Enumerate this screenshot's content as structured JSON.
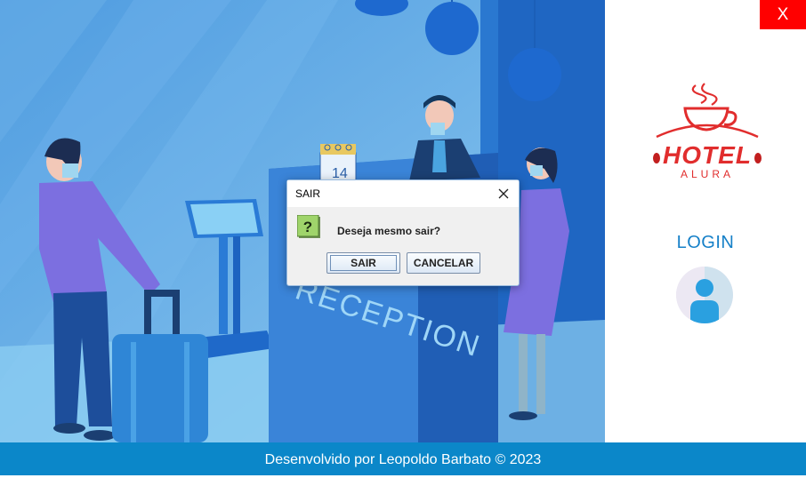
{
  "window": {
    "close_label": "X"
  },
  "scene": {
    "calendar_day": "14",
    "reception_sign": "RECEPTION"
  },
  "logo": {
    "word1": "HOTEL",
    "word2": "ALURA"
  },
  "login": {
    "label": "LOGIN"
  },
  "dialog": {
    "title": "SAIR",
    "message": "Deseja mesmo sair?",
    "confirm_label": "SAIR",
    "cancel_label": "CANCELAR",
    "icon": "question-icon"
  },
  "footer": {
    "text": "Desenvolvido por Leopoldo Barbato © 2023"
  },
  "colors": {
    "close_button": "#ff0000",
    "footer": "#0b87c9",
    "login_text": "#1680c8",
    "logo_red": "#e12d2d"
  }
}
